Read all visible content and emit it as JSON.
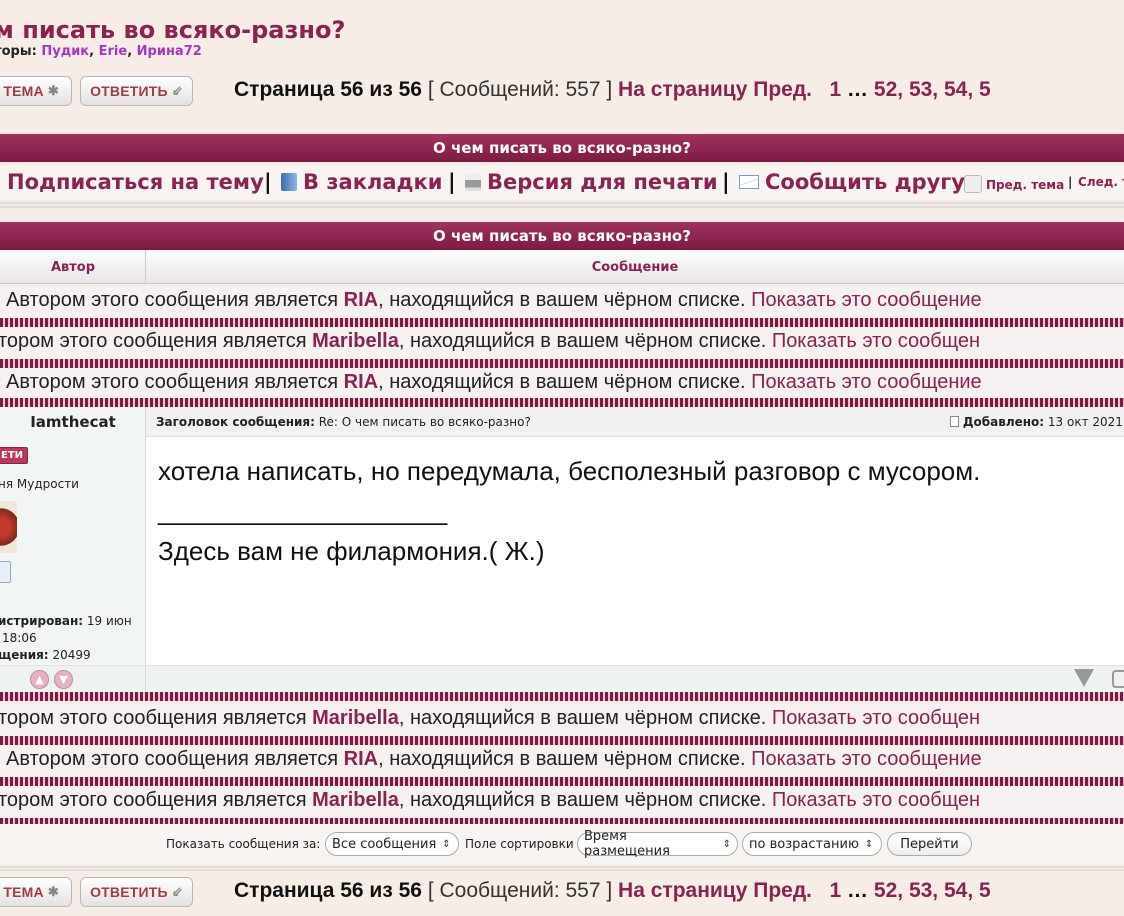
{
  "topic": {
    "title": "ем писать во всяко-разно?",
    "moderators_label": "раторы:",
    "moderators": [
      "Пудик",
      "Erie",
      "Ирина72"
    ]
  },
  "buttons": {
    "new_topic": "Я ТЕМА",
    "reply": "ОТВЕТИТЬ",
    "go": "Перейти"
  },
  "pagination": {
    "page_label": "Страница 56 из 56",
    "posts_label": "[ Сообщений: 557 ]",
    "goto_label": "На страницу",
    "prev": "Пред.",
    "pages": [
      "1",
      "…",
      "52,",
      "53,",
      "54,",
      "5"
    ]
  },
  "header_bar": "О чем писать во всяко-разно?",
  "links": {
    "subscribe": "Подписаться на тему",
    "bookmark": "В закладки",
    "print": "Версия для печати",
    "email": "Сообщить другу",
    "prev_topic": "Пред. тема",
    "next_topic": "След. т"
  },
  "columns": {
    "author": "Автор",
    "message": "Сообщение"
  },
  "blocked_prefix_a": "Автором этого сообщения является",
  "blocked_prefix_b": "тором этого сообщения является",
  "blocked_suffix": ", находящийся в вашем чёрном списке.",
  "blocked_show_a": "Показать это сообщение",
  "blocked_show_b": "Показать это сообщен",
  "blocked_users": {
    "ria": "RIA",
    "maribella": "Maribella"
  },
  "post": {
    "author": "Iamthecat",
    "badge": "ЕТИ",
    "rank": "ня Мудрости",
    "registered_label": "истрирован:",
    "registered_value": "19 июн",
    "registered_time": "18:06",
    "posts_label": "щения:",
    "posts_value": "20499",
    "subject_label": "Заголовок сообщения:",
    "subject_value": "Re: О чем писать во всяко-разно?",
    "added_label": "Добавлено:",
    "added_value": "13 окт 2021",
    "line1": "хотела написать, но передумала, бесполезный разговор с мусором.",
    "signature_line": "____________________",
    "signature": "Здесь вам не филармония.( Ж.)"
  },
  "filters": {
    "show_label": "Показать сообщения за:",
    "show_value": "Все сообщения",
    "sort_label": "Поле сортировки",
    "sort_value": "Время размещения",
    "order_value": "по возрастанию"
  },
  "colors": {
    "accent": "#8b2252",
    "bar": "#7c1a44",
    "background": "#f5ede6"
  }
}
